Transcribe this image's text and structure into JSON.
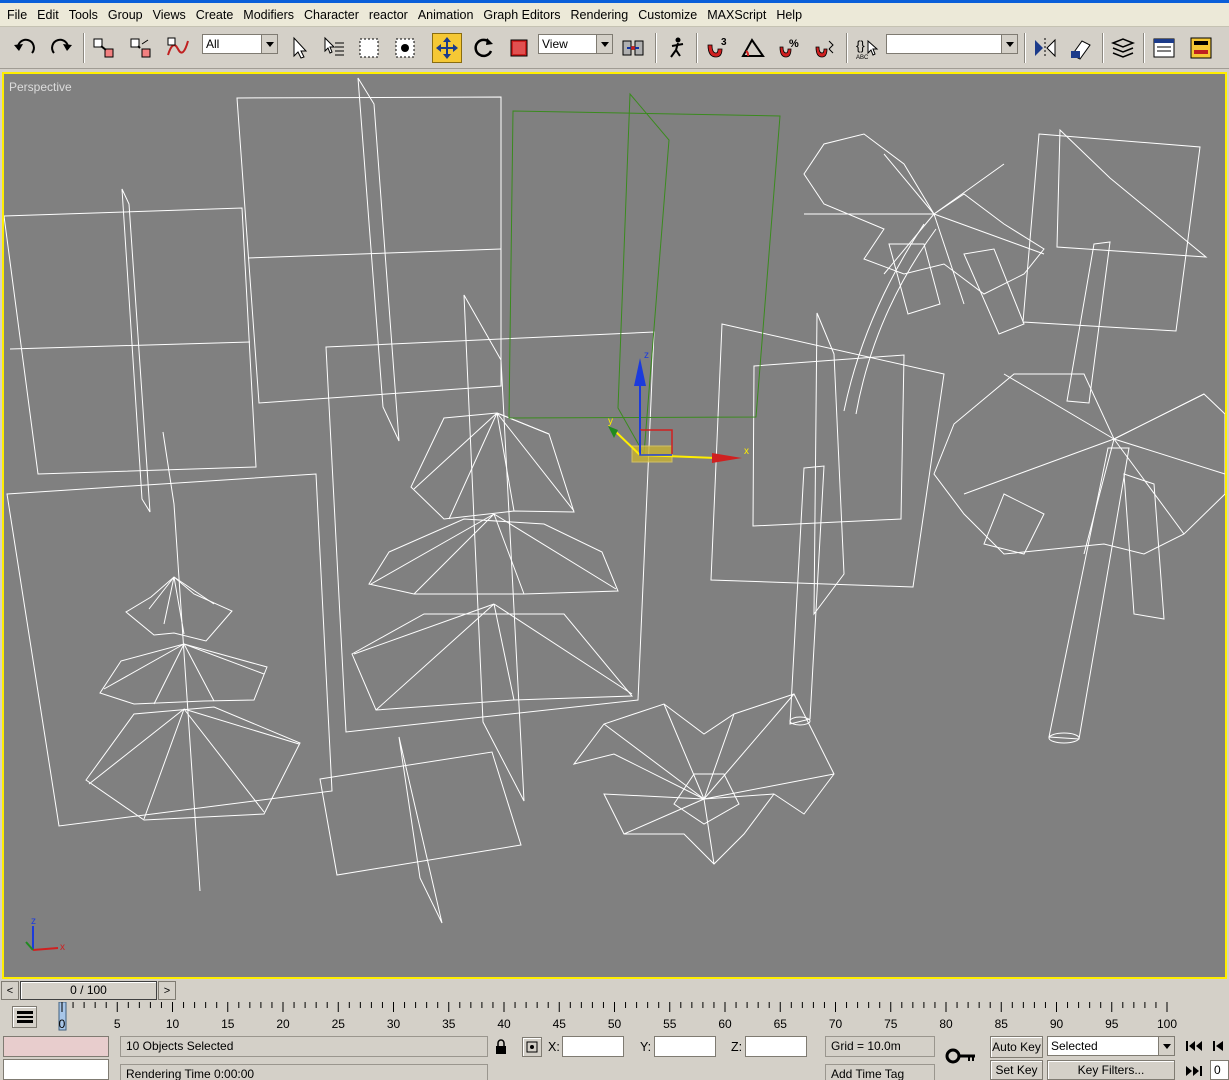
{
  "menu": [
    "File",
    "Edit",
    "Tools",
    "Group",
    "Views",
    "Create",
    "Modifiers",
    "Character",
    "reactor",
    "Animation",
    "Graph Editors",
    "Rendering",
    "Customize",
    "MAXScript",
    "Help"
  ],
  "toolbar": {
    "selection_filter": "All",
    "reference_coord": "View",
    "named_selection": "",
    "snap_angle_label": "3",
    "percent_snap_label": "%"
  },
  "viewport": {
    "label": "Perspective",
    "gizmo_axes": {
      "x": "x",
      "y": "y",
      "z": "z"
    },
    "world_axes": {
      "x": "x",
      "z": "z"
    }
  },
  "timeline": {
    "slider_text": "0 / 100",
    "ticks": [
      "0",
      "5",
      "10",
      "15",
      "20",
      "25",
      "30",
      "35",
      "40",
      "45",
      "50",
      "55",
      "60",
      "65",
      "70",
      "75",
      "80",
      "85",
      "90",
      "95",
      "100"
    ]
  },
  "status": {
    "selection_text": "10 Objects Selected",
    "prompt_text": "Rendering Time  0:00:00",
    "x_label": "X:",
    "y_label": "Y:",
    "z_label": "Z:",
    "x_value": "",
    "y_value": "",
    "z_value": "",
    "grid_text": "Grid = 10.0m",
    "add_time_tag": "Add Time Tag",
    "auto_key": "Auto Key",
    "set_key": "Set Key",
    "key_mode": "Selected",
    "key_filters": "Key Filters...",
    "frame_value": "0"
  },
  "colors": {
    "viewport_bg": "#808080",
    "active_border": "#ffee00",
    "wire": "#ffffff",
    "selected_bbox": "#3a8a1e",
    "ui_face": "#d4d0c8"
  }
}
